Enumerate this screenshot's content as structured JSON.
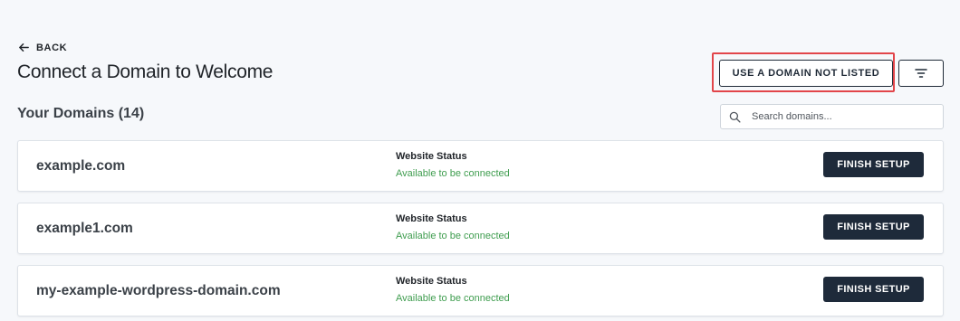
{
  "header": {
    "back_label": "BACK",
    "title": "Connect a Domain to Welcome",
    "use_domain_label": "USE A DOMAIN NOT LISTED",
    "filter_icon": "filter-icon"
  },
  "domains_section": {
    "heading": "Your Domains (14)",
    "search_placeholder": "Search domains...",
    "search_value": ""
  },
  "domains": [
    {
      "name": "example.com",
      "status_label": "Website Status",
      "status_value": "Available to be connected",
      "action_label": "FINISH SETUP"
    },
    {
      "name": "example1.com",
      "status_label": "Website Status",
      "status_value": "Available to be connected",
      "action_label": "FINISH SETUP"
    },
    {
      "name": "my-example-wordpress-domain.com",
      "status_label": "Website Status",
      "status_value": "Available to be connected",
      "action_label": "FINISH SETUP"
    }
  ],
  "colors": {
    "background": "#f6f8fb",
    "primary_button": "#1e2a3a",
    "status_available": "#3f9d4f",
    "highlight_box": "#e2454a"
  }
}
